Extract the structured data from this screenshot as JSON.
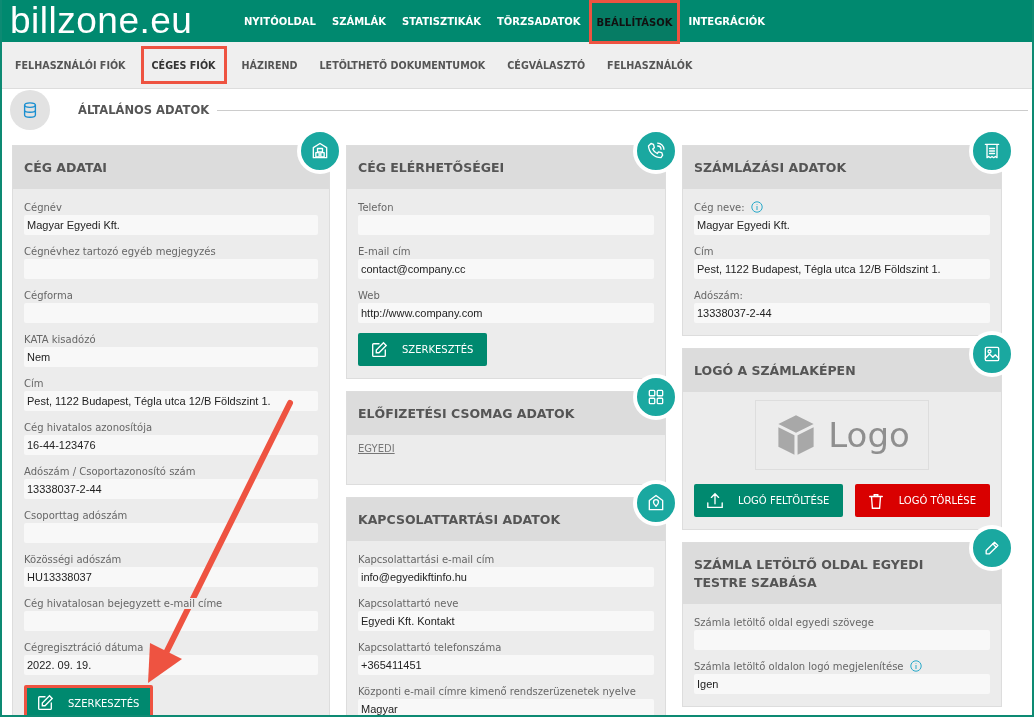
{
  "logo": "billzone.eu",
  "nav": [
    {
      "label": "NYITÓOLDAL",
      "selected": false,
      "highlighted": false
    },
    {
      "label": "SZÁMLÁK",
      "selected": false,
      "highlighted": false
    },
    {
      "label": "STATISZTIKÁK",
      "selected": false,
      "highlighted": false
    },
    {
      "label": "TÖRZSADATOK",
      "selected": false,
      "highlighted": false
    },
    {
      "label": "BEÁLLÍTÁSOK",
      "selected": true,
      "highlighted": true
    },
    {
      "label": "INTEGRÁCIÓK",
      "selected": false,
      "highlighted": false
    }
  ],
  "subnav": [
    {
      "label": "FELHASZNÁLÓI FIÓK",
      "selected": false,
      "highlighted": false
    },
    {
      "label": "CÉGES FIÓK",
      "selected": true,
      "highlighted": true
    },
    {
      "label": "HÁZIREND",
      "selected": false,
      "highlighted": false
    },
    {
      "label": "LETÖLTHETŐ DOKUMENTUMOK",
      "selected": false,
      "highlighted": false
    },
    {
      "label": "CÉGVÁLASZTÓ",
      "selected": false,
      "highlighted": false
    },
    {
      "label": "FELHASZNÁLÓK",
      "selected": false,
      "highlighted": false
    }
  ],
  "section": {
    "title": "ÁLTALÁNOS ADATOK"
  },
  "columns": [
    [
      {
        "kind": "fields",
        "title": "CÉG ADATAI",
        "fields": [
          {
            "label": "Cégnév",
            "value": "Magyar Egyedi Kft.",
            "info": false
          },
          {
            "label": "Cégnévhez tartozó egyéb megjegyzés",
            "info": false
          },
          {
            "label": "Cégforma",
            "info": false
          },
          {
            "label": "KATA kisadózó",
            "value": "Nem",
            "info": false
          },
          {
            "label": "Cím",
            "value": "Pest, 1122 Budapest, Tégla utca 12/B Földszint 1.",
            "info": false
          },
          {
            "label": "Cég hivatalos azonosítója",
            "value": "16-44-123476",
            "info": false
          },
          {
            "label": "Adószám / Csoportazonosító szám",
            "value": "13338037-2-44",
            "info": false
          },
          {
            "label": "Csoporttag adószám",
            "info": false
          },
          {
            "label": "Közösségi adószám",
            "value": "HU13338037",
            "info": false
          },
          {
            "label": "Cég hivatalosan bejegyzett e-mail címe",
            "info": false
          },
          {
            "label": "Cégregisztráció dátuma",
            "value": "2022. 09. 19.",
            "info": false
          }
        ],
        "buttons": [
          {
            "kind": "edit",
            "label": "SZERKESZTÉS",
            "highlighted": true
          }
        ]
      }
    ],
    [
      {
        "kind": "fields",
        "title": "CÉG ELÉRHETŐSÉGEI",
        "fields": [
          {
            "label": "Telefon",
            "info": false
          },
          {
            "label": "E-mail cím",
            "value": "contact@company.cc",
            "info": false
          },
          {
            "label": "Web",
            "value": "http://www.company.com",
            "info": false
          }
        ],
        "buttons": [
          {
            "kind": "edit",
            "label": "SZERKESZTÉS",
            "highlighted": false
          }
        ]
      },
      {
        "kind": "link",
        "title": "ELŐFIZETÉSI CSOMAG ADATOK",
        "link": "EGYEDI"
      },
      {
        "kind": "fields",
        "title": "KAPCSOLATTARTÁSI ADATOK",
        "fields": [
          {
            "label": "Kapcsolattartási e-mail cím",
            "value": "info@egyedikftinfo.hu",
            "info": false
          },
          {
            "label": "Kapcsolattartó neve",
            "value": "Egyedi Kft. Kontakt",
            "info": false
          },
          {
            "label": "Kapcsolattartó telefonszáma",
            "value": "+365411451",
            "info": false
          },
          {
            "label": "Központi e-mail címre kimenő rendszerüzenetek nyelve",
            "value": "Magyar",
            "info": false
          }
        ]
      }
    ],
    [
      {
        "kind": "fields",
        "title": "SZÁMLÁZÁSI ADATOK",
        "fields": [
          {
            "label": "Cég neve:",
            "value": "Magyar Egyedi Kft.",
            "info": true
          },
          {
            "label": "Cím",
            "value": "Pest, 1122 Budapest, Tégla utca 12/B Földszint 1.",
            "info": false
          },
          {
            "label": "Adószám:",
            "value": "13338037-2-44",
            "info": false
          }
        ]
      },
      {
        "kind": "logo",
        "title": "LOGÓ A SZÁMLAKÉPEN",
        "placeholder": "Logo",
        "buttons": [
          {
            "kind": "upload",
            "label": "LOGÓ FELTÖLTÉSE",
            "highlighted": false
          },
          {
            "kind": "delete",
            "label": "LOGÓ TÖRLÉSE",
            "highlighted": false
          }
        ]
      },
      {
        "kind": "fields",
        "title": "SZÁMLA LETÖLTŐ OLDAL EGYEDI TESTRE SZABÁSA",
        "fields": [
          {
            "label": "Számla letöltő oldal egyedi szövege",
            "info": false
          },
          {
            "label": "Számla letöltő oldalon logó megjelenítése",
            "value": "Igen",
            "info": true
          }
        ]
      }
    ]
  ],
  "annotations": {
    "arrow": true
  }
}
